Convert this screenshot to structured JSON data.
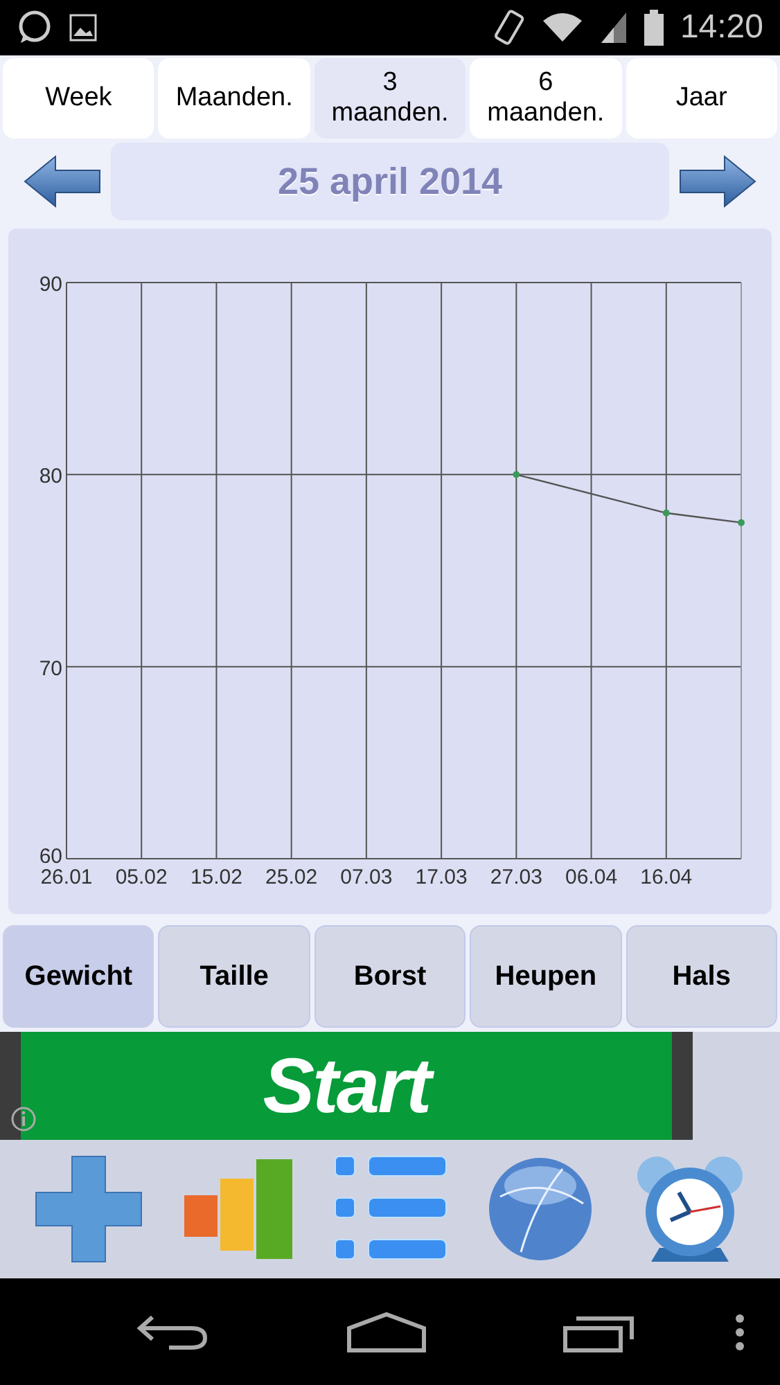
{
  "status_bar": {
    "time": "14:20"
  },
  "period_tabs": [
    {
      "label": "Week",
      "selected": false
    },
    {
      "label": "Maanden.",
      "selected": false
    },
    {
      "label": "3\nmaanden.",
      "selected": true
    },
    {
      "label": "6\nmaanden.",
      "selected": false
    },
    {
      "label": "Jaar",
      "selected": false
    }
  ],
  "date_nav": {
    "date": "25 april 2014"
  },
  "chart": {
    "chart_data": {
      "type": "line",
      "categories": [
        "26.01",
        "05.02",
        "15.02",
        "25.02",
        "07.03",
        "17.03",
        "27.03",
        "06.04",
        "16.04",
        null
      ],
      "grid": true,
      "series": [
        {
          "color": "#555555",
          "marker": "circle",
          "values": [
            null,
            null,
            null,
            null,
            null,
            null,
            80,
            null,
            78,
            77.5
          ]
        }
      ],
      "ylim": [
        60,
        90
      ],
      "yticks": [
        60,
        70,
        80,
        90
      ]
    }
  },
  "measure_tabs": [
    {
      "label": "Gewicht",
      "selected": true
    },
    {
      "label": "Taille",
      "selected": false
    },
    {
      "label": "Borst",
      "selected": false
    },
    {
      "label": "Heupen",
      "selected": false
    },
    {
      "label": "Hals",
      "selected": false
    }
  ],
  "ad_banner": {
    "text": "Start"
  }
}
